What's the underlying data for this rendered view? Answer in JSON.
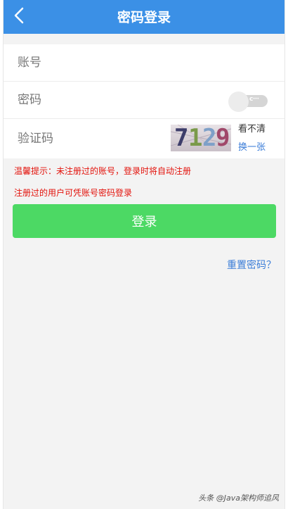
{
  "header": {
    "title": "密码登录",
    "back_icon": "chevron-left-icon",
    "background": "#3b90e6"
  },
  "form": {
    "account_placeholder": "账号",
    "password_placeholder": "密码",
    "password_toggle_label": "c···",
    "captcha_placeholder": "验证码",
    "captcha_text": "7129",
    "captcha_hint": "看不清",
    "captcha_refresh": "换一张"
  },
  "tips": {
    "line1": "温馨提示：未注册过的账号，登录时将自动注册",
    "line2": "注册过的用户可凭账号密码登录"
  },
  "login_button": {
    "label": "登录",
    "color": "#4cd964"
  },
  "reset_link": "重置密码？",
  "watermark": "头条 @Java架构师追风"
}
